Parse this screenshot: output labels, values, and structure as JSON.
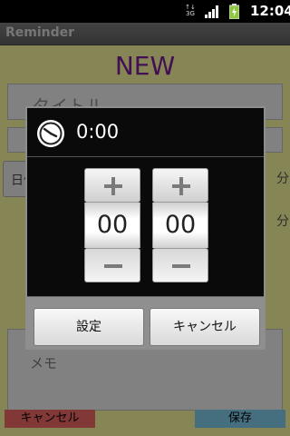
{
  "status_bar": {
    "network": "3G",
    "time": "12:04",
    "battery_color": "#8dc63f"
  },
  "app": {
    "title": "Reminder"
  },
  "form": {
    "heading": "NEW",
    "title_placeholder": "タイトル",
    "date_button": "日付",
    "unit_1": "分",
    "unit_2": "分",
    "memo_placeholder": "メモ",
    "cancel_button": "キャンセル",
    "save_button": "保存",
    "heading_color": "#7a1a99",
    "background_color": "#f3f29b"
  },
  "dialog": {
    "title": "0:00",
    "hour_value": "00",
    "minute_value": "00",
    "set_button": "設定",
    "cancel_button": "キャンセル"
  }
}
